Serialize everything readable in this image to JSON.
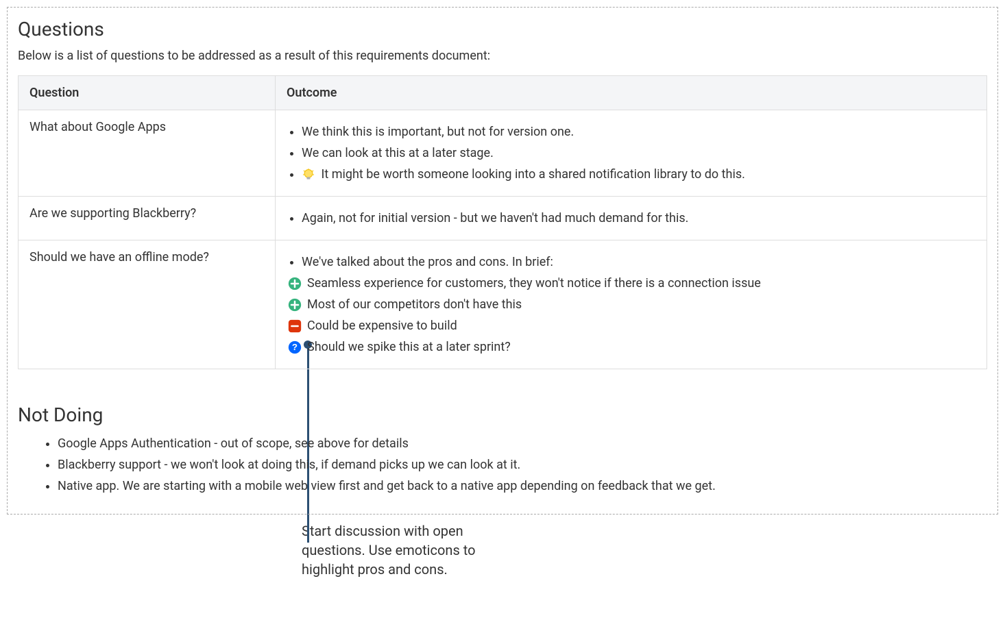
{
  "questions_heading": "Questions",
  "questions_intro": "Below is a list of questions to be addressed as a result of this requirements document:",
  "table": {
    "header_question": "Question",
    "header_outcome": "Outcome",
    "rows": [
      {
        "question": "What about Google Apps",
        "outcomes": [
          {
            "type": "bullet",
            "text": "We think this is important, but not for version one."
          },
          {
            "type": "bullet",
            "text": "We can look at this at a later stage."
          },
          {
            "type": "bullet-icon",
            "icon": "lightbulb",
            "text": "It might be worth someone looking into a shared notification library to do this."
          }
        ]
      },
      {
        "question": "Are we supporting Blackberry?",
        "outcomes": [
          {
            "type": "bullet",
            "text": "Again, not for initial version - but we haven't had much demand for this."
          }
        ]
      },
      {
        "question": "Should we have an offline mode?",
        "outcomes": [
          {
            "type": "bullet",
            "text": "We've talked about the pros and cons. In brief:"
          },
          {
            "type": "icon",
            "icon": "plus",
            "text": "Seamless experience for customers, they won't notice if there is a connection issue"
          },
          {
            "type": "icon",
            "icon": "plus",
            "text": "Most of our competitors don't have this"
          },
          {
            "type": "icon",
            "icon": "minus",
            "text": "Could be expensive to build"
          },
          {
            "type": "icon",
            "icon": "question",
            "text": "Should we spike this at a later sprint?"
          }
        ]
      }
    ]
  },
  "not_doing_heading": "Not Doing",
  "not_doing_items": [
    "Google Apps Authentication - out of scope, see above for details",
    "Blackberry support - we won't look at doing this, if demand picks up we can look at it.",
    "Native app. We are starting with a mobile web view first and get back to a native app depending on feedback that we get."
  ],
  "annotation": "Start discussion with open questions. Use emoticons to highlight pros and cons."
}
